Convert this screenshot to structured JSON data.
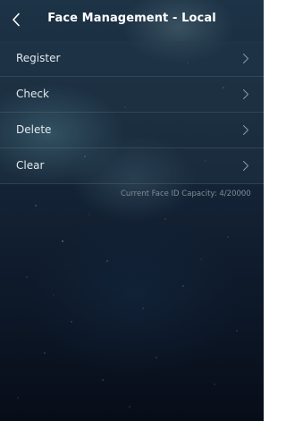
{
  "header": {
    "title": "Face Management - Local",
    "back_icon": "chevron-left-icon"
  },
  "menu": {
    "items": [
      {
        "label": "Register",
        "icon": "chevron-right-icon"
      },
      {
        "label": "Check",
        "icon": "chevron-right-icon"
      },
      {
        "label": "Delete",
        "icon": "chevron-right-icon"
      },
      {
        "label": "Clear",
        "icon": "chevron-right-icon"
      }
    ]
  },
  "capacity_text": "Current Face ID Capacity: 4/20000",
  "colors": {
    "title_text": "#ffffff",
    "menu_text": "#e3e9ee",
    "capacity_text": "#7f8c97",
    "background_dark": "#0b1524"
  }
}
